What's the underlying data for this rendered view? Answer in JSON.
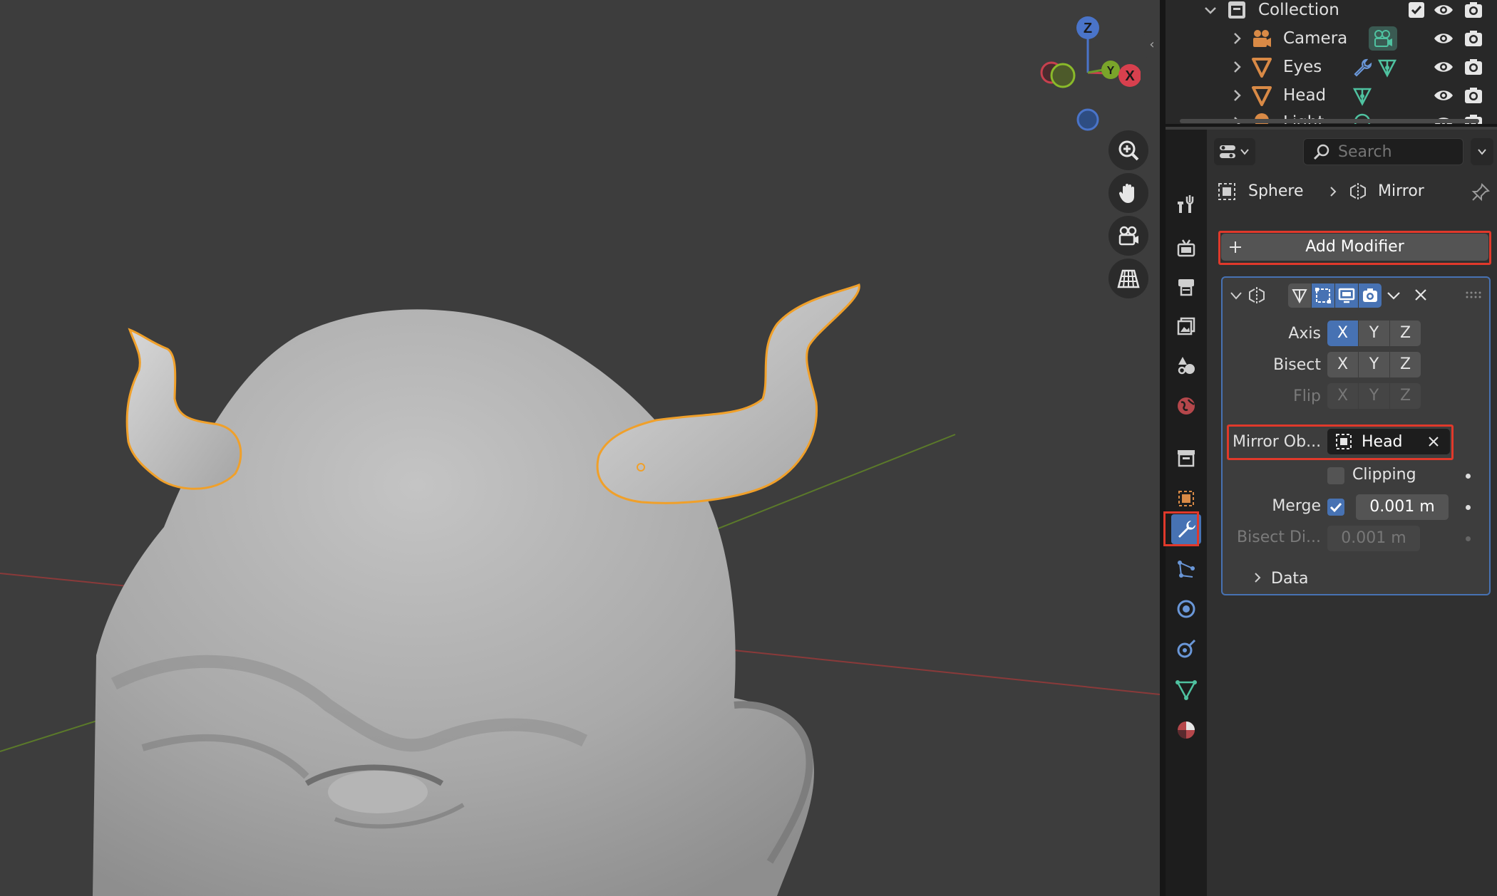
{
  "outliner": {
    "rows": [
      {
        "label": "Collection",
        "icon": "collection-icon"
      },
      {
        "label": "Camera",
        "icon": "camera-object-icon"
      },
      {
        "label": "Eyes",
        "icon": "mesh-object-icon"
      },
      {
        "label": "Head",
        "icon": "mesh-object-icon"
      },
      {
        "label": "Light",
        "icon": "light-object-icon"
      }
    ]
  },
  "header": {
    "search_placeholder": "Search"
  },
  "breadcrumb": {
    "object": "Sphere",
    "modifier": "Mirror"
  },
  "add_modifier_label": "Add Modifier",
  "modifier": {
    "axis_label": "Axis",
    "bisect_label": "Bisect",
    "flip_label": "Flip",
    "axis_buttons": [
      "X",
      "Y",
      "Z"
    ],
    "axis_active": "X",
    "mirror_object_label": "Mirror Ob...",
    "mirror_object_value": "Head",
    "clipping_label": "Clipping",
    "clipping_checked": false,
    "merge_label": "Merge",
    "merge_checked": true,
    "merge_value": "0.001 m",
    "bisect_distance_label": "Bisect Di...",
    "bisect_distance_value": "0.001 m",
    "data_label": "Data"
  },
  "gizmo": {
    "z_label": "Z",
    "y_label": "Y",
    "x_label": "X"
  },
  "colors": {
    "accent": "#4772b3",
    "highlight": "#e0392b",
    "selection_outline": "#f0a02a"
  }
}
